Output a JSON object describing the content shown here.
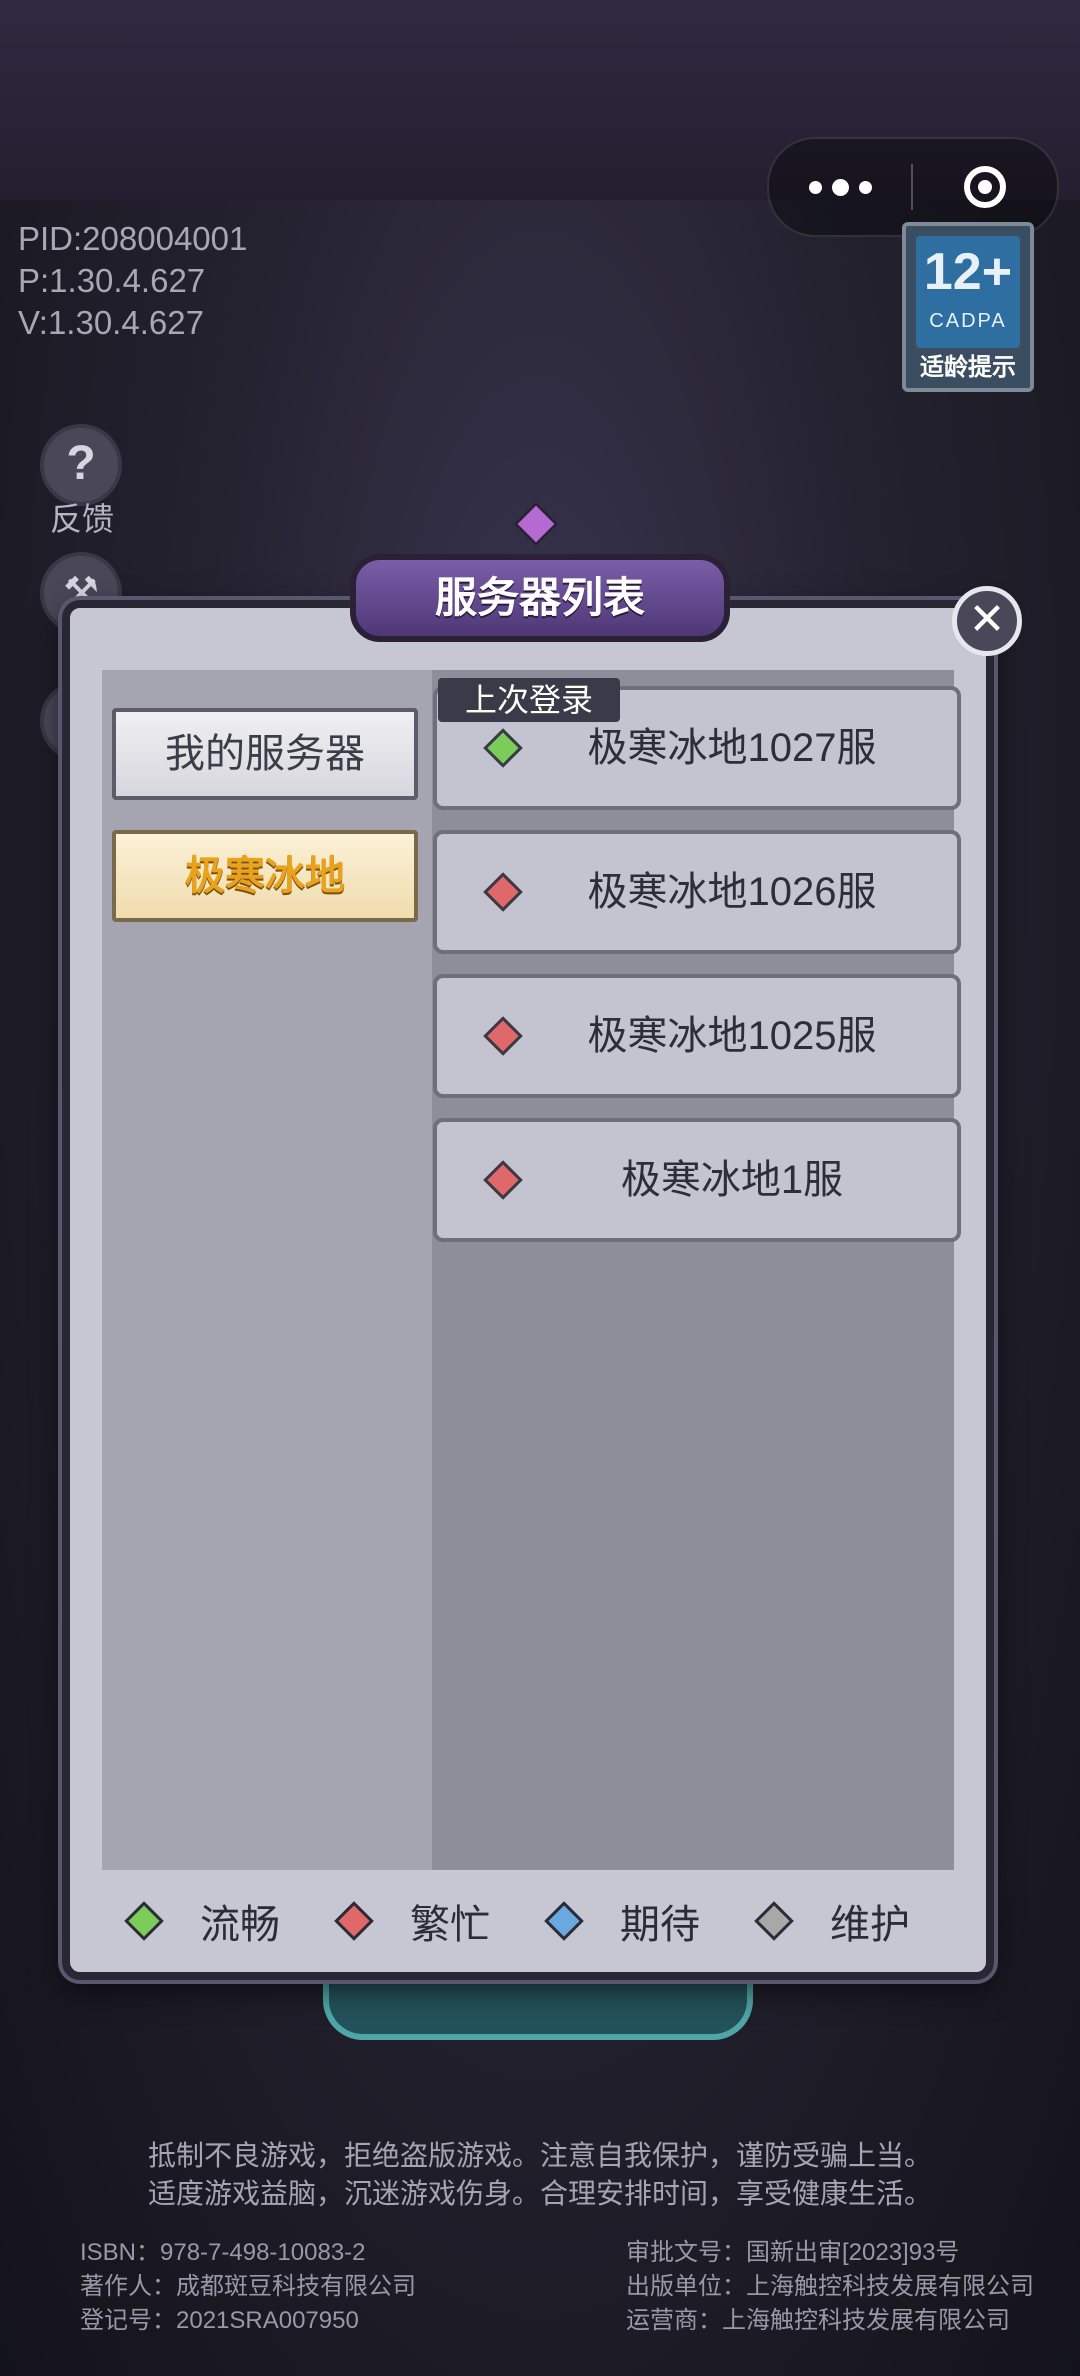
{
  "version_info": {
    "pid": "PID:208004001",
    "p": "P:1.30.4.627",
    "v": "V:1.30.4.627"
  },
  "age_rating": {
    "age": "12+",
    "org": "CADPA",
    "tip": "适龄提示"
  },
  "side_menu": {
    "feedback_label": "反馈",
    "feedback_icon": "?"
  },
  "modal": {
    "title": "服务器列表",
    "close_icon": "✕",
    "tabs": [
      {
        "label": "我的服务器"
      },
      {
        "label": "极寒冰地"
      }
    ],
    "last_login_tag": "上次登录",
    "servers": [
      {
        "name": "极寒冰地1027服",
        "status": "流畅",
        "color": "#7ccc5a"
      },
      {
        "name": "极寒冰地1026服",
        "status": "繁忙",
        "color": "#e0686a"
      },
      {
        "name": "极寒冰地1025服",
        "status": "繁忙",
        "color": "#e0686a"
      },
      {
        "name": "极寒冰地1服",
        "status": "繁忙",
        "color": "#e0686a"
      }
    ],
    "legend": [
      {
        "label": "流畅",
        "color": "#7ccc5a"
      },
      {
        "label": "繁忙",
        "color": "#e0686a"
      },
      {
        "label": "期待",
        "color": "#6aa8e0"
      },
      {
        "label": "维护",
        "color": "#a8a8a8"
      }
    ]
  },
  "footer": {
    "line1": "抵制不良游戏，拒绝盗版游戏。注意自我保护，谨防受骗上当。",
    "line2": "适度游戏益脑，沉迷游戏伤身。合理安排时间，享受健康生活。",
    "isbn": "ISBN：978-7-498-10083-2",
    "author": "著作人：成都斑豆科技有限公司",
    "reg": "登记号：2021SRA007950",
    "approval": "审批文号：国新出审[2023]93号",
    "publisher": "出版单位：上海触控科技发展有限公司",
    "operator": "运营商：上海触控科技发展有限公司"
  }
}
